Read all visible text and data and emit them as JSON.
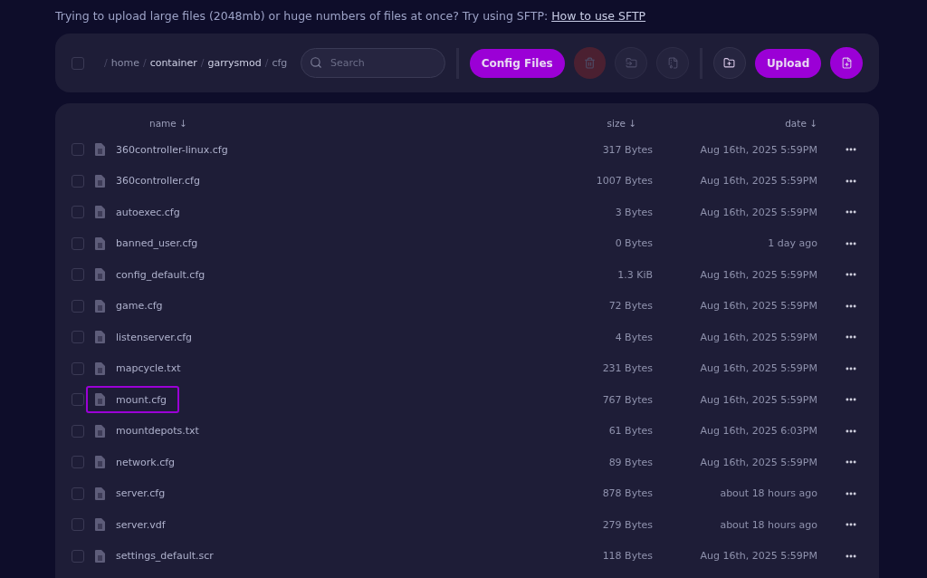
{
  "notice": {
    "text": "Trying to upload large files (2048mb) or huge numbers of files at once? Try using SFTP:",
    "link": "How to use SFTP"
  },
  "toolbar": {
    "select_all": {
      "checked": false
    },
    "breadcrumb": [
      {
        "separator": "/",
        "label": "home",
        "current": false
      },
      {
        "separator": "/",
        "label": "container",
        "current": true
      },
      {
        "separator": "/",
        "label": "garrysmod",
        "current": true
      },
      {
        "separator": "/",
        "label": "cfg",
        "current": false
      }
    ],
    "search": {
      "placeholder": "Search"
    },
    "buttons": [
      {
        "kind": "text",
        "label": "Config Files",
        "disabled": false
      },
      {
        "kind": "icon",
        "disabled": true
      },
      {
        "kind": "icon",
        "disabled": true
      },
      {
        "kind": "icon",
        "disabled": true
      },
      {
        "kind": "divider"
      },
      {
        "kind": "icon",
        "disabled": false
      },
      {
        "kind": "text",
        "label": "Upload",
        "disabled": false
      },
      {
        "kind": "icon",
        "disabled": false
      }
    ]
  },
  "table": {
    "columns": [
      {
        "label": "name ↓"
      },
      {
        "label": "size ↓"
      },
      {
        "label": "date ↓"
      }
    ],
    "rows": [
      {
        "name": "360controller-linux.cfg",
        "size": "317 Bytes",
        "date": "Aug 16th, 2025 5:59PM",
        "checked": false,
        "highlighted": false
      },
      {
        "name": "360controller.cfg",
        "size": "1007 Bytes",
        "date": "Aug 16th, 2025 5:59PM",
        "checked": false,
        "highlighted": false
      },
      {
        "name": "autoexec.cfg",
        "size": "3 Bytes",
        "date": "Aug 16th, 2025 5:59PM",
        "checked": false,
        "highlighted": false
      },
      {
        "name": "banned_user.cfg",
        "size": "0 Bytes",
        "date": "1 day ago",
        "checked": false,
        "highlighted": false
      },
      {
        "name": "config_default.cfg",
        "size": "1.3 KiB",
        "date": "Aug 16th, 2025 5:59PM",
        "checked": false,
        "highlighted": false
      },
      {
        "name": "game.cfg",
        "size": "72 Bytes",
        "date": "Aug 16th, 2025 5:59PM",
        "checked": false,
        "highlighted": false
      },
      {
        "name": "listenserver.cfg",
        "size": "4 Bytes",
        "date": "Aug 16th, 2025 5:59PM",
        "checked": false,
        "highlighted": false
      },
      {
        "name": "mapcycle.txt",
        "size": "231 Bytes",
        "date": "Aug 16th, 2025 5:59PM",
        "checked": false,
        "highlighted": false
      },
      {
        "name": "mount.cfg",
        "size": "767 Bytes",
        "date": "Aug 16th, 2025 5:59PM",
        "checked": false,
        "highlighted": true
      },
      {
        "name": "mountdepots.txt",
        "size": "61 Bytes",
        "date": "Aug 16th, 2025 6:03PM",
        "checked": false,
        "highlighted": false
      },
      {
        "name": "network.cfg",
        "size": "89 Bytes",
        "date": "Aug 16th, 2025 5:59PM",
        "checked": false,
        "highlighted": false
      },
      {
        "name": "server.cfg",
        "size": "878 Bytes",
        "date": "about 18 hours ago",
        "checked": false,
        "highlighted": false
      },
      {
        "name": "server.vdf",
        "size": "279 Bytes",
        "date": "about 18 hours ago",
        "checked": false,
        "highlighted": false
      },
      {
        "name": "settings_default.scr",
        "size": "118 Bytes",
        "date": "Aug 16th, 2025 5:59PM",
        "checked": false,
        "highlighted": false
      }
    ]
  }
}
